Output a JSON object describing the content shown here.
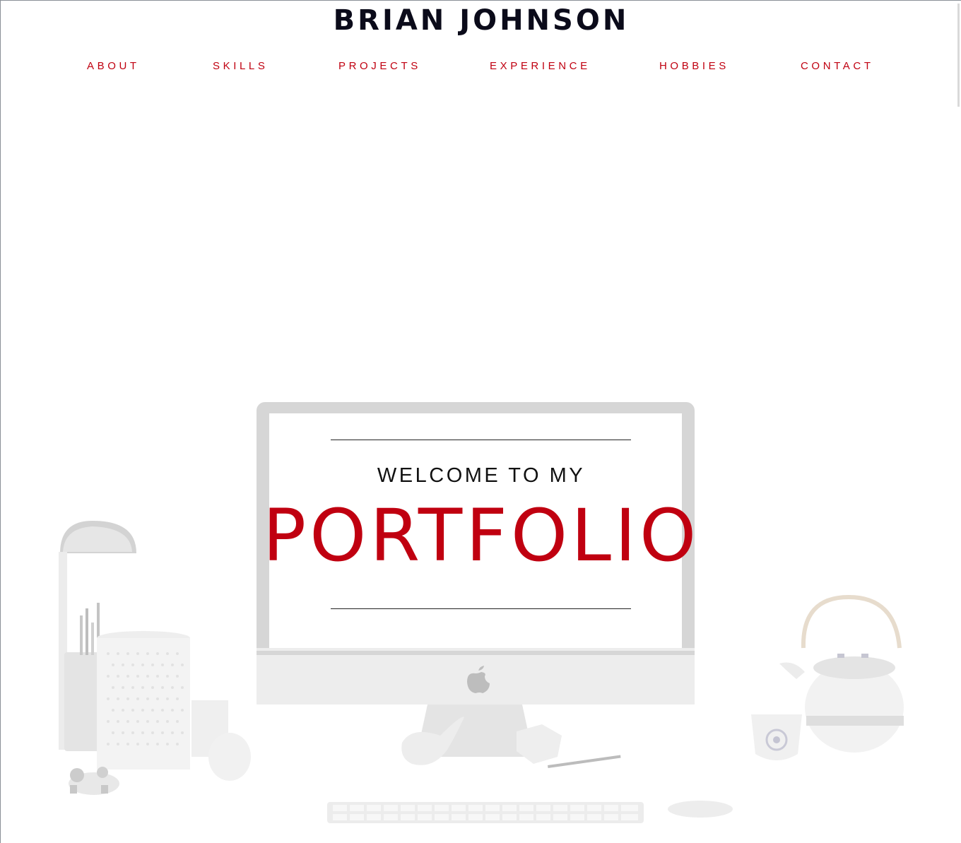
{
  "site": {
    "title": "BRIAN JOHNSON"
  },
  "nav": {
    "items": [
      {
        "label": "ABOUT"
      },
      {
        "label": "SKILLS"
      },
      {
        "label": "PROJECTS"
      },
      {
        "label": "EXPERIENCE"
      },
      {
        "label": "HOBBIES"
      },
      {
        "label": "CONTACT"
      }
    ]
  },
  "hero": {
    "welcome": "WELCOME TO MY",
    "headline": "PORTFOLIO",
    "background_icon": "desk-workspace-illustration",
    "monitor_logo_icon": "apple-logo-icon"
  },
  "colors": {
    "accent": "#c00010",
    "title": "#0b0b1a",
    "text": "#111111",
    "background": "#ffffff",
    "illustration_gray": "#d6d6d6"
  }
}
